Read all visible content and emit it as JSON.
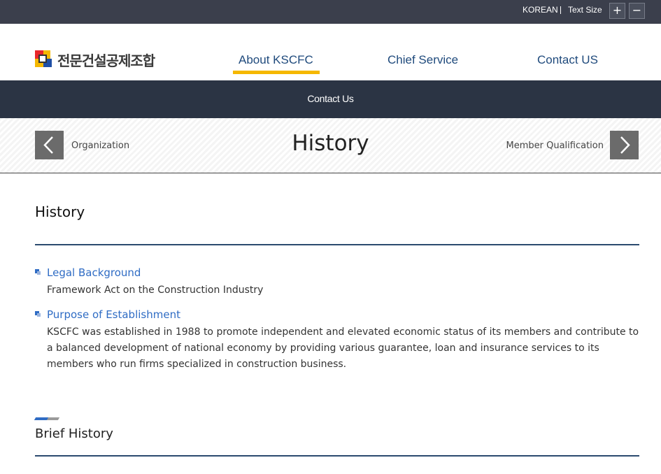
{
  "topbar": {
    "language": "KOREAN",
    "text_size_label": "Text Size",
    "increase_symbol": "+",
    "decrease_symbol": "−"
  },
  "logo": {
    "text": "전문건설공제조합",
    "colors": {
      "red": "#e8262a",
      "yellow": "#f5b800",
      "blue": "#1f4fa5",
      "dark": "#333333"
    }
  },
  "nav": {
    "items": [
      {
        "label": "About KSCFC",
        "active": true
      },
      {
        "label": "Chief Service",
        "active": false
      },
      {
        "label": "Contact US",
        "active": false
      }
    ],
    "active_color": "#f5b800"
  },
  "subnav": {
    "label": "Contact Us"
  },
  "page_nav": {
    "prev_label": "Organization",
    "title": "History",
    "next_label": "Member Qualification"
  },
  "content": {
    "section_title": "History",
    "items": [
      {
        "heading": "Legal Background",
        "body": "Framework Act on the Construction Industry"
      },
      {
        "heading": "Purpose of Establishment",
        "body": "KSCFC was established in 1988 to promote independent and elevated economic status of its members and contribute to a balanced development of national economy by providing various guarantee, loan and insurance services to its members who run firms specialized in construction business."
      }
    ],
    "brief_history_title": "Brief History"
  },
  "colors": {
    "topbar_bg": "#3b3f4c",
    "subbar_bg": "#2b3444",
    "link_blue": "#2f6cc4",
    "nav_blue": "#1f4a7c"
  }
}
